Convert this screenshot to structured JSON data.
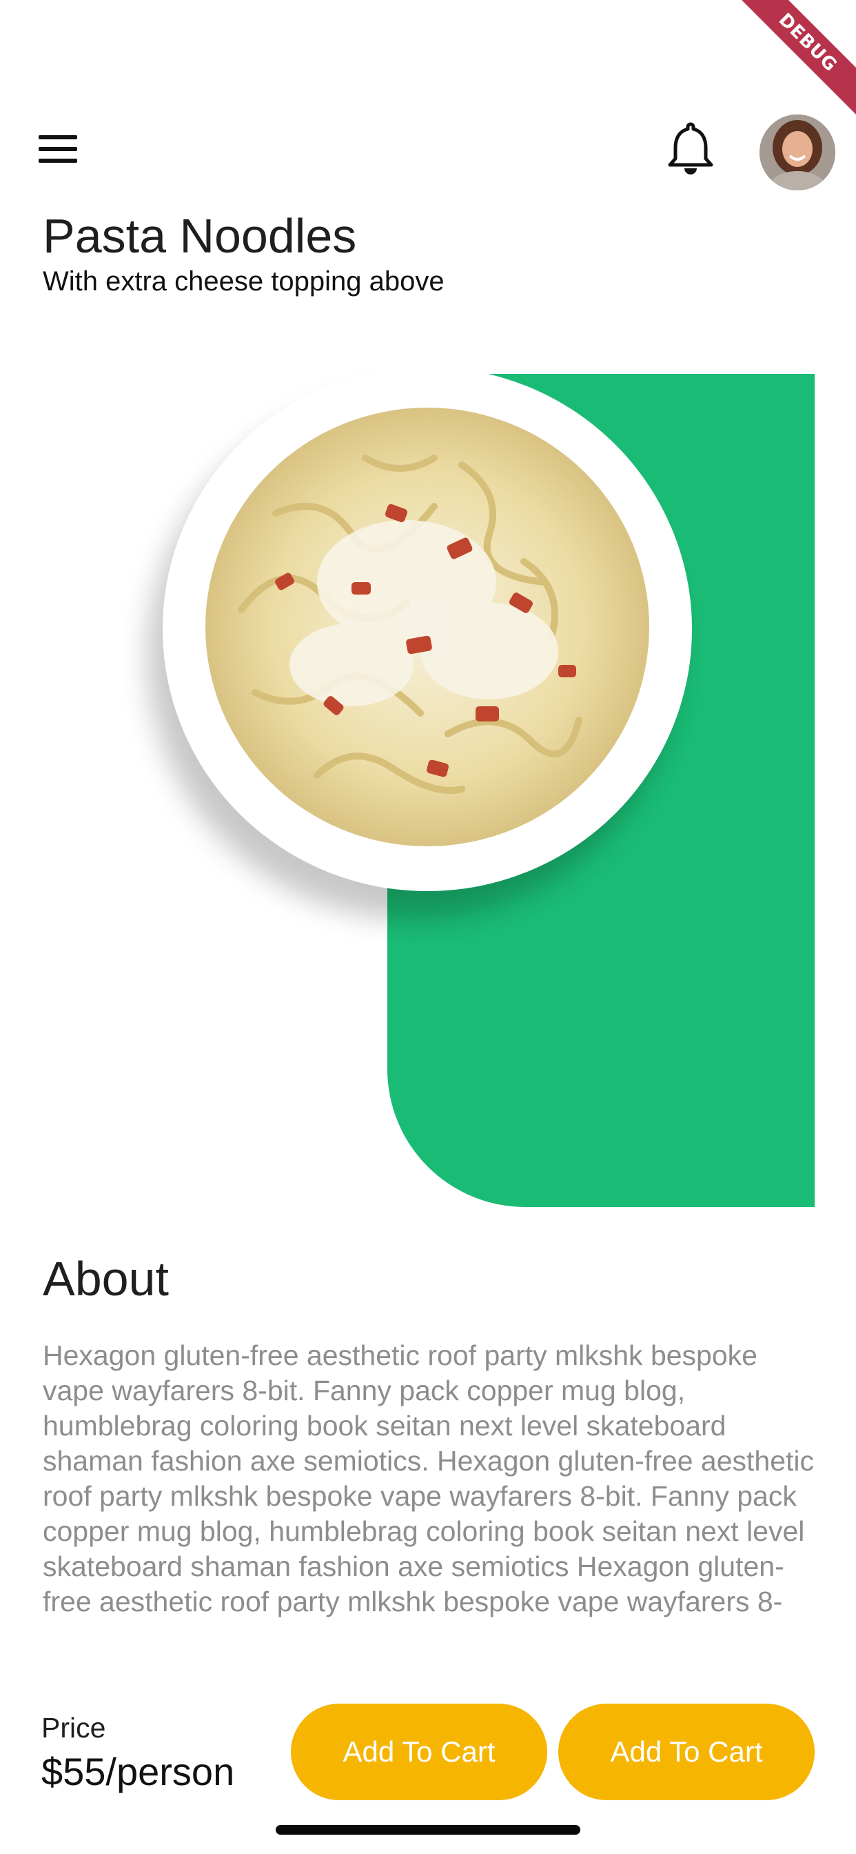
{
  "debug_banner": "DEBUG",
  "header": {
    "menu_icon": "hamburger-menu-icon",
    "notification_icon": "bell-icon",
    "avatar_icon": "user-avatar"
  },
  "product": {
    "title": "Pasta Noodles",
    "subtitle": "With extra cheese topping above",
    "image_icon": "pasta-plate-image"
  },
  "about": {
    "title": "About",
    "text": "Hexagon gluten-free aesthetic roof party mlkshk bespoke vape wayfarers 8-bit. Fanny pack copper mug blog, humblebrag coloring book seitan next level skateboard shaman fashion axe semiotics. Hexagon gluten-free aesthetic roof party mlkshk bespoke vape wayfarers 8-bit. Fanny pack copper mug blog, humblebrag coloring book seitan next level skateboard shaman fashion axe semiotics Hexagon gluten-free aesthetic roof party mlkshk bespoke vape wayfarers 8-"
  },
  "footer": {
    "price_label": "Price",
    "price_value": "$55/person",
    "buttons": [
      {
        "label": "Add To Cart"
      },
      {
        "label": "Add To Cart"
      }
    ]
  },
  "colors": {
    "accent_green": "#1abb74",
    "button_yellow": "#f6b500",
    "debug_red": "#b6334b",
    "body_text_gray": "#8d8d8d"
  }
}
